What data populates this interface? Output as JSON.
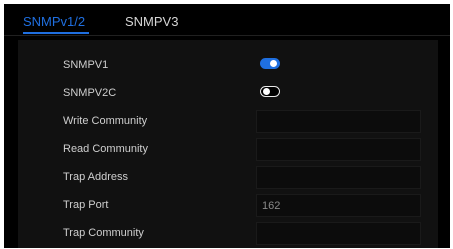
{
  "tabs": [
    {
      "label": "SNMPv1/2",
      "active": true
    },
    {
      "label": "SNMPV3",
      "active": false
    }
  ],
  "accent_color": "#1f6fe0",
  "settings": {
    "snmpv1": {
      "label": "SNMPV1",
      "enabled": true
    },
    "snmpv2c": {
      "label": "SNMPV2C",
      "enabled": false
    },
    "write_community": {
      "label": "Write Community",
      "value": ""
    },
    "read_community": {
      "label": "Read Community",
      "value": ""
    },
    "trap_address": {
      "label": "Trap Address",
      "value": ""
    },
    "trap_port": {
      "label": "Trap Port",
      "value": "162"
    },
    "trap_community": {
      "label": "Trap Community",
      "value": ""
    }
  }
}
